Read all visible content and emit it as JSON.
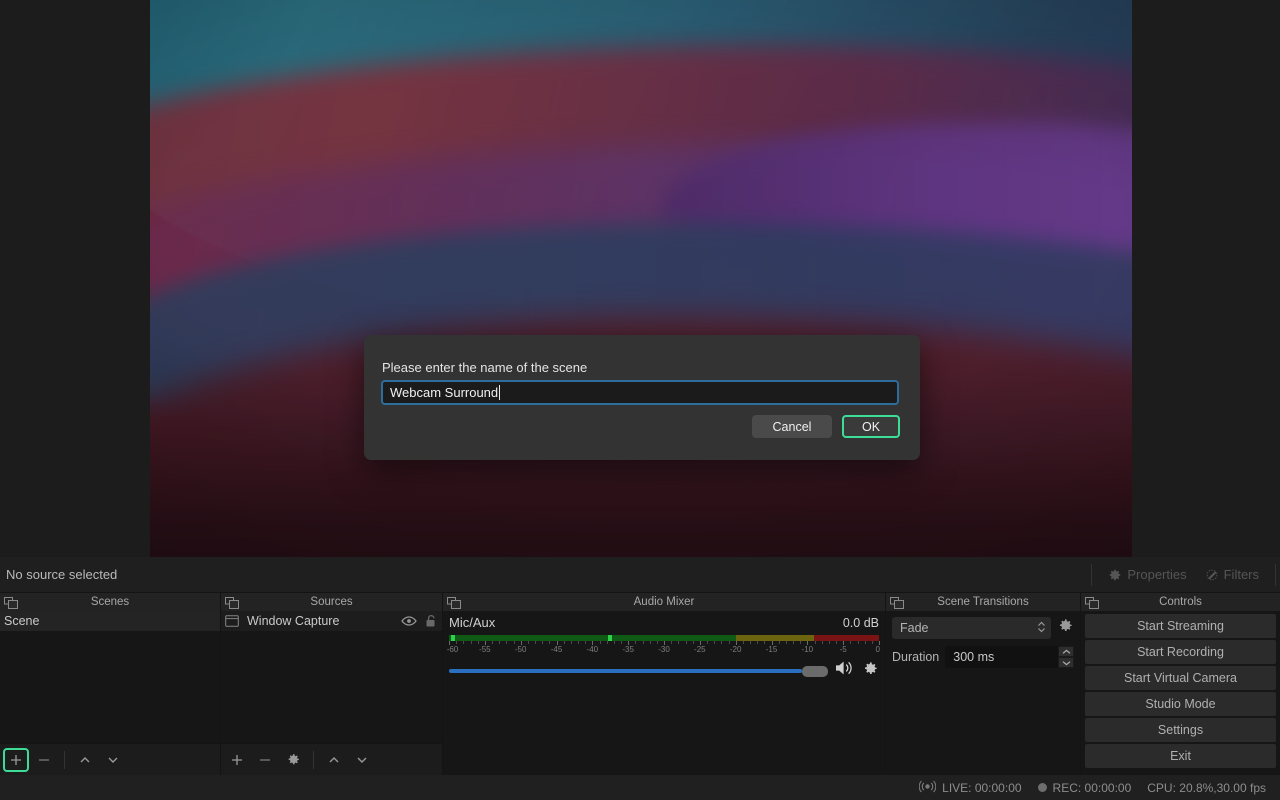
{
  "preview": {
    "name": "program-preview",
    "wallpaper": "macos-big-sur-gradient"
  },
  "source_toolbar": {
    "status": "No source selected",
    "properties_label": "Properties",
    "filters_label": "Filters"
  },
  "docks": {
    "scenes": {
      "title": "Scenes",
      "items": [
        {
          "name": "Scene"
        }
      ],
      "footer": [
        "add",
        "remove",
        "move-up",
        "move-down"
      ]
    },
    "sources": {
      "title": "Sources",
      "items": [
        {
          "name": "Window Capture",
          "visible": true,
          "locked": false
        }
      ],
      "footer": [
        "add",
        "remove",
        "properties",
        "move-up",
        "move-down"
      ]
    },
    "audio_mixer": {
      "title": "Audio Mixer",
      "channels": [
        {
          "name": "Mic/Aux",
          "db": "0.0 dB",
          "volume_percent": 100,
          "meter": {
            "min": -60,
            "max": 0,
            "green_end": -20,
            "yellow_end": -9,
            "peaks_db": [
              -59.5,
              -37.5
            ],
            "tick_labels": [
              "-60",
              "-55",
              "-50",
              "-45",
              "-40",
              "-35",
              "-30",
              "-25",
              "-20",
              "-15",
              "-10",
              "-5",
              "0"
            ]
          }
        }
      ]
    },
    "scene_transitions": {
      "title": "Scene Transitions",
      "transition": "Fade",
      "duration_label": "Duration",
      "duration_value": "300 ms"
    },
    "controls": {
      "title": "Controls",
      "buttons": [
        {
          "label": "Start Streaming"
        },
        {
          "label": "Start Recording"
        },
        {
          "label": "Start Virtual Camera"
        },
        {
          "label": "Studio Mode"
        },
        {
          "label": "Settings"
        },
        {
          "label": "Exit"
        }
      ]
    }
  },
  "statusbar": {
    "live": "LIVE: 00:00:00",
    "rec": "REC: 00:00:00",
    "cpu": "CPU: 20.8%,30.00 fps"
  },
  "dialog": {
    "prompt": "Please enter the name of the scene",
    "input_value": "Webcam Surround",
    "cancel_label": "Cancel",
    "ok_label": "OK"
  },
  "colors": {
    "focus_green": "#3ddc97",
    "input_border_blue": "#2d6d9e",
    "meter_green": "#0f5a14",
    "meter_yellow": "#6d6410",
    "meter_red": "#7a1414",
    "slider_blue": "#2a6fc0"
  }
}
